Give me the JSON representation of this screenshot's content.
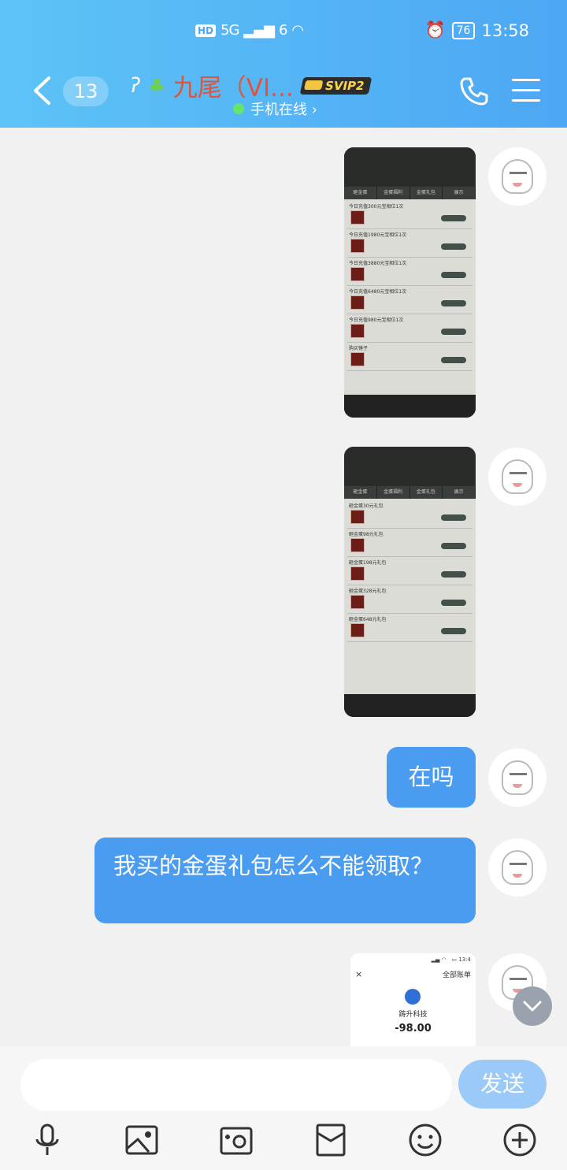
{
  "status_bar": {
    "hd": "HD",
    "network": "5G",
    "wifi": "6",
    "battery": "76",
    "time": "13:58"
  },
  "header": {
    "unread_count": "13",
    "title": "九尾（VI...",
    "badge": "SVIP2",
    "presence": "手机在线 ›"
  },
  "messages": [
    {
      "type": "image",
      "tabs": [
        "砸金蛋",
        "金蛋福利",
        "金蛋礼包",
        "展示"
      ],
      "rows": [
        "今日充值300元宝相位1次",
        "今日充值1980元宝相位1次",
        "今日充值3880元宝相位1次",
        "今日充值6480元宝相位1次",
        "今日充值980元宝相位1次",
        "购买锤子"
      ]
    },
    {
      "type": "image",
      "tabs": [
        "砸金蛋",
        "金蛋福利",
        "金蛋礼包",
        "展示"
      ],
      "rows": [
        "砸金蛋30元礼包",
        "砸金蛋98元礼包",
        "砸金蛋198元礼包",
        "砸金蛋328元礼包",
        "砸金蛋648元礼包"
      ]
    },
    {
      "type": "text",
      "text": "在吗"
    },
    {
      "type": "text",
      "text": "我买的金蛋礼包怎么不能领取？"
    },
    {
      "type": "receipt",
      "close": "×",
      "link": "全部账单",
      "merchant": "踌升科技",
      "amount": "-98.00"
    }
  ],
  "composer": {
    "input_value": "",
    "send_label": "发送"
  },
  "colors": {
    "header_start": "#5dc3f7",
    "header_end": "#4da7f3",
    "bubble": "#4a9cf0",
    "send_disabled": "#9ccaf8",
    "title": "#e0553a"
  },
  "toolbar_icons": [
    "microphone-icon",
    "photo-icon",
    "camera-icon",
    "red-packet-icon",
    "emoji-icon",
    "plus-icon"
  ]
}
